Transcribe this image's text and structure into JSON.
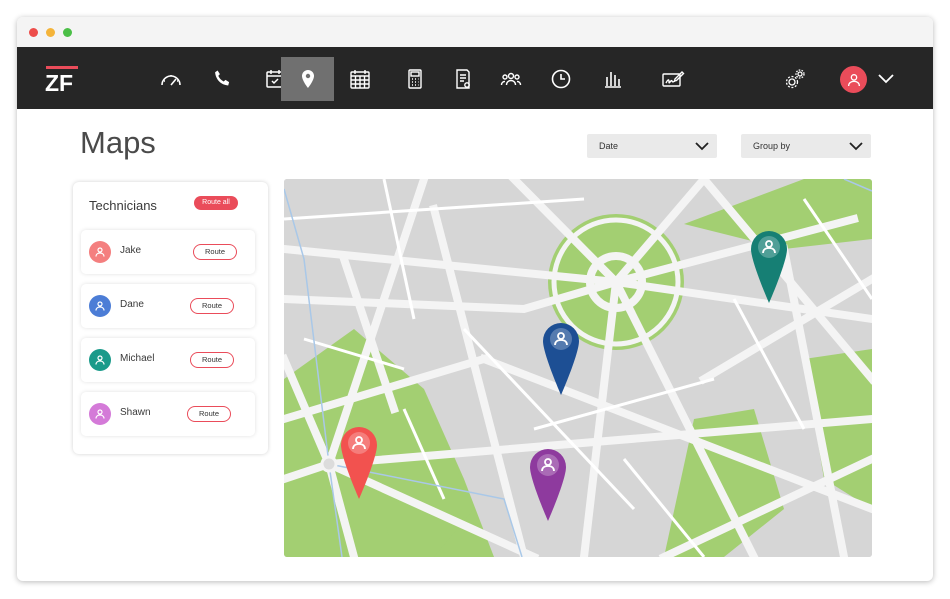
{
  "colors": {
    "accent": "#ea4c5a",
    "navbar": "#262626",
    "nav_active": "#707070",
    "map_block": "#d6d6d6",
    "map_park": "#a3cf72",
    "map_road": "#f4f4f4"
  },
  "window_controls": [
    "close",
    "minimize",
    "zoom"
  ],
  "navbar": {
    "logo_text": "ZF",
    "items": [
      {
        "icon": "speedometer-icon",
        "active": false
      },
      {
        "icon": "phone-icon",
        "active": false
      },
      {
        "icon": "calendar-check-icon",
        "active": false
      },
      {
        "icon": "map-pin-icon",
        "active": true
      },
      {
        "icon": "calendar-grid-icon",
        "active": false
      },
      {
        "icon": "calculator-icon",
        "active": false
      },
      {
        "icon": "invoice-icon",
        "active": false
      },
      {
        "icon": "team-icon",
        "active": false
      },
      {
        "icon": "clock-icon",
        "active": false
      },
      {
        "icon": "bar-chart-icon",
        "active": false
      },
      {
        "icon": "signature-icon",
        "active": false
      }
    ],
    "settings_icon": "gears-icon",
    "user_icon": "user-icon"
  },
  "page": {
    "title": "Maps"
  },
  "filters": {
    "date_label": "Date",
    "group_by_label": "Group by"
  },
  "technicians": {
    "title": "Technicians",
    "route_all_label": "Route all",
    "route_label": "Route",
    "items": [
      {
        "name": "Jake",
        "color": "#f47f7f"
      },
      {
        "name": "Dane",
        "color": "#4c7dd6"
      },
      {
        "name": "Michael",
        "color": "#1a9a8a"
      },
      {
        "name": "Shawn",
        "color": "#d47ad8"
      }
    ]
  },
  "map": {
    "pins": [
      {
        "technician": "Jake",
        "color": "#f2524f"
      },
      {
        "technician": "Dane",
        "color": "#1d4f94"
      },
      {
        "technician": "Michael",
        "color": "#167f74"
      },
      {
        "technician": "Shawn",
        "color": "#8e3a9e"
      }
    ]
  }
}
